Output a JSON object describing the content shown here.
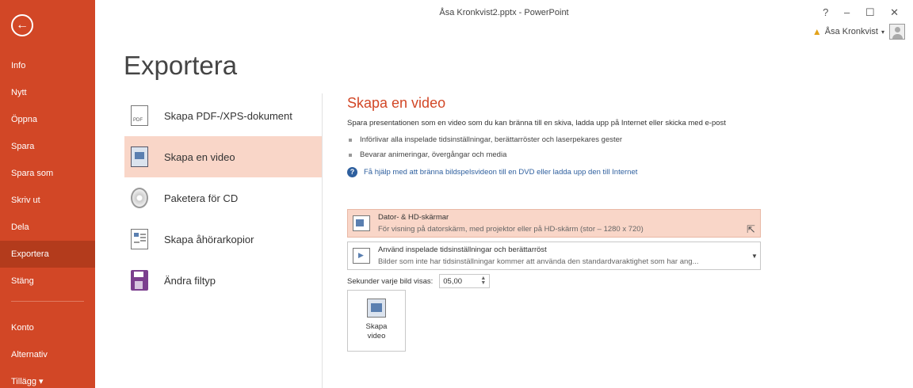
{
  "window": {
    "title": "Åsa Kronkvist2.pptx - PowerPoint",
    "controls": {
      "help": "?",
      "minimize": "–",
      "maximize": "☐",
      "close": "✕"
    },
    "user_name": "Åsa Kronkvist",
    "user_caret": "▾"
  },
  "nav": {
    "back_glyph": "←",
    "items": [
      "Info",
      "Nytt",
      "Öppna",
      "Spara",
      "Spara som",
      "Skriv ut",
      "Dela",
      "Exportera",
      "Stäng"
    ],
    "active": "Exportera",
    "bottom_items": [
      "Konto",
      "Alternativ",
      "Tillägg ▾"
    ]
  },
  "page_title": "Exportera",
  "options": [
    {
      "label": "Skapa PDF-/XPS-dokument",
      "icon": "pdf-document-icon"
    },
    {
      "label": "Skapa en video",
      "icon": "video-icon",
      "active": true
    },
    {
      "label": "Paketera för CD",
      "icon": "cd-icon"
    },
    {
      "label": "Skapa åhörarkopior",
      "icon": "handout-icon"
    },
    {
      "label": "Ändra filtyp",
      "icon": "save-as-icon"
    }
  ],
  "detail": {
    "heading": "Skapa en video",
    "description": "Spara presentationen som en video som du kan bränna till en skiva, ladda upp på Internet eller skicka med e-post",
    "bullets": [
      "Införlivar alla inspelade tidsinställningar, berättarröster och laserpekares gester",
      "Bevarar animeringar, övergångar och media"
    ],
    "help_link": "Få hjälp med att bränna bildspelsvideon till en DVD eller ladda upp den till Internet",
    "quality_dropdown": {
      "title": "Dator- & HD-skärmar",
      "subtitle": "För visning på datorskärm, med projektor eller på HD-skärm (stor – 1280 x 720)"
    },
    "timing_dropdown": {
      "title": "Använd inspelade tidsinställningar och berättarröst",
      "subtitle": "Bilder som inte har tidsinställningar kommer att använda den standardvaraktighet som har ang..."
    },
    "seconds_label": "Sekunder varje bild visas:",
    "seconds_value": "05,00",
    "create_button": "Skapa video"
  },
  "colors": {
    "accent": "#d24726",
    "accent_dark": "#b33b1c",
    "selected_bg": "#f9d6c8",
    "link": "#2e5f9e"
  }
}
